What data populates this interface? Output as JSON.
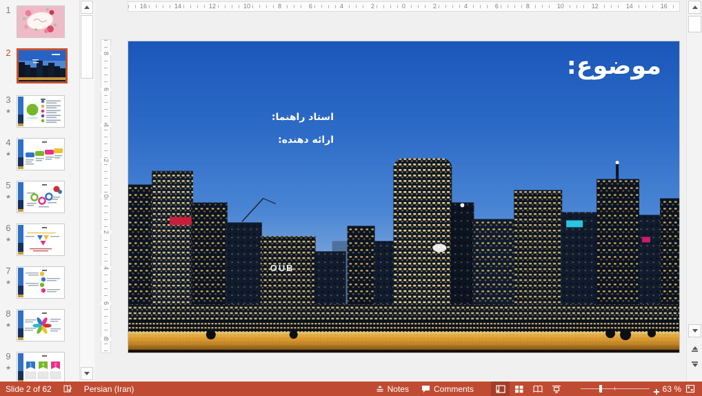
{
  "colors": {
    "accent": "#C04B33",
    "selection_border": "#C4502E",
    "status_bar_bg": "#C04B33",
    "pressed_view_btn": "#A33E29"
  },
  "status_bar": {
    "slide_indicator": "Slide 2 of 62",
    "language": "Persian (Iran)",
    "notes_label": "Notes",
    "comments_label": "Comments",
    "zoom_level": "63 %"
  },
  "sidebar": {
    "slides": [
      {
        "number": "1",
        "starred": false,
        "selected": false
      },
      {
        "number": "2",
        "starred": false,
        "selected": true
      },
      {
        "number": "3",
        "starred": true,
        "selected": false
      },
      {
        "number": "4",
        "starred": true,
        "selected": false
      },
      {
        "number": "5",
        "starred": true,
        "selected": false
      },
      {
        "number": "6",
        "starred": true,
        "selected": false
      },
      {
        "number": "7",
        "starred": true,
        "selected": false
      },
      {
        "number": "8",
        "starred": true,
        "selected": false
      },
      {
        "number": "9",
        "starred": true,
        "selected": false
      }
    ],
    "slide9_tags": [
      "1",
      "4",
      "2"
    ]
  },
  "rulers": {
    "horizontal": [
      "16",
      "14",
      "12",
      "10",
      "8",
      "6",
      "4",
      "2",
      "0",
      "2",
      "4",
      "6",
      "8",
      "10",
      "12",
      "14",
      "16"
    ],
    "vertical": [
      "8",
      "6",
      "4",
      "2",
      "0",
      "2",
      "4",
      "6",
      "8"
    ]
  },
  "slide": {
    "title": "موضوع:",
    "supervisor_label": "استاد راهنما:",
    "presenter_label": "ارائه دهنده:",
    "photo_sign": "OUB"
  },
  "icons": {
    "star": "★"
  }
}
